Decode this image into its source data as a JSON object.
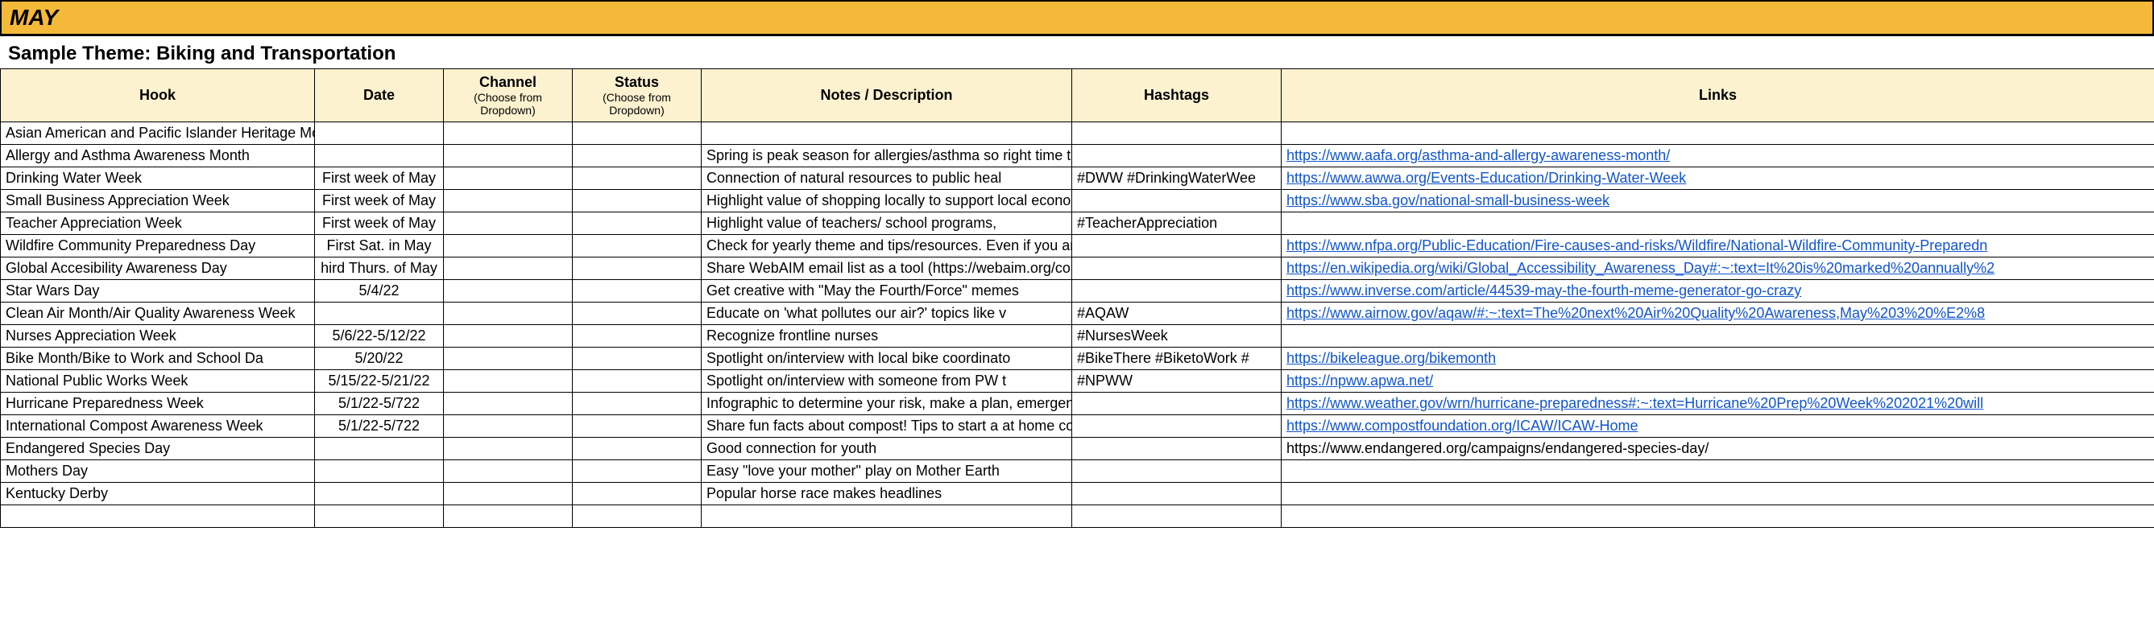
{
  "month_title": "MAY",
  "theme": "Sample Theme: Biking and Transportation",
  "columns": {
    "hook": "Hook",
    "date": "Date",
    "channel": "Channel",
    "channel_sub": "(Choose from Dropdown)",
    "status": "Status",
    "status_sub": "(Choose from Dropdown)",
    "notes": "Notes / Description",
    "hashtags": "Hashtags",
    "links": "Links"
  },
  "rows": [
    {
      "hook": "Asian American and Pacific Islander Heritage Month",
      "date": "",
      "notes": "",
      "hashtags": "",
      "link": "",
      "linkIsUrl": false
    },
    {
      "hook": "Allergy and Asthma Awareness Month",
      "date": "",
      "notes": "Spring is peak season for allergies/asthma so right time to educate about t",
      "hashtags": "",
      "link": "https://www.aafa.org/asthma-and-allergy-awareness-month/",
      "linkIsUrl": true
    },
    {
      "hook": "Drinking Water Week",
      "date": "First week of May",
      "notes": "Connection of natural resources to public heal",
      "hashtags": "#DWW #DrinkingWaterWee",
      "link": "https://www.awwa.org/Events-Education/Drinking-Water-Week",
      "linkIsUrl": true
    },
    {
      "hook": "Small Business Appreciation Week",
      "date": "First week of May",
      "notes": "Highlight value of shopping locally to support local economy, call out speci",
      "hashtags": "",
      "link": "https://www.sba.gov/national-small-business-week",
      "linkIsUrl": true
    },
    {
      "hook": "Teacher Appreciation Week",
      "date": "First week of May",
      "notes": "Highlight value of teachers/ school programs,",
      "hashtags": "#TeacherAppreciation",
      "link": "",
      "linkIsUrl": false
    },
    {
      "hook": "Wildfire Community Preparedness Day",
      "date": "First Sat. in May",
      "notes": "Check for yearly theme and tips/resources. Even if you are not in an area",
      "hashtags": "",
      "link": "https://www.nfpa.org/Public-Education/Fire-causes-and-risks/Wildfire/National-Wildfire-Community-Preparedn",
      "linkIsUrl": true
    },
    {
      "hook": "Global Accesibility Awareness Day",
      "date": "hird Thurs. of May",
      "notes": "Share WebAIM email list as a tool (https://webaim.org/contact/)",
      "hashtags": "",
      "link": "https://en.wikipedia.org/wiki/Global_Accessibility_Awareness_Day#:~:text=It%20is%20marked%20annually%2",
      "linkIsUrl": true
    },
    {
      "hook": "Star Wars Day",
      "date": "5/4/22",
      "notes": "Get creative with \"May the Fourth/Force\" memes",
      "hashtags": "",
      "link": "https://www.inverse.com/article/44539-may-the-fourth-meme-generator-go-crazy",
      "linkIsUrl": true
    },
    {
      "hook": "Clean Air Month/Air Quality Awareness Week",
      "date": "",
      "notes": "Educate on 'what pollutes our air?' topics like v",
      "hashtags": "#AQAW",
      "link": "https://www.airnow.gov/aqaw/#:~:text=The%20next%20Air%20Quality%20Awareness,May%203%20%E2%8",
      "linkIsUrl": true
    },
    {
      "hook": "Nurses Appreciation Week",
      "date": "5/6/22-5/12/22",
      "notes": "Recognize frontline nurses",
      "hashtags": "#NursesWeek",
      "link": "",
      "linkIsUrl": false
    },
    {
      "hook": "Bike Month/Bike to Work and School Da",
      "date": "5/20/22",
      "notes": "Spotlight on/interview with local bike coordinato",
      "hashtags": "#BikeThere #BiketoWork #",
      "link": "https://bikeleague.org/bikemonth",
      "linkIsUrl": true
    },
    {
      "hook": "National Public Works Week",
      "date": "5/15/22-5/21/22",
      "notes": "Spotlight on/interview with someone from PW t",
      "hashtags": "#NPWW",
      "link": "https://npww.apwa.net/",
      "linkIsUrl": true
    },
    {
      "hook": "Hurricane Preparedness Week",
      "date": "5/1/22-5/722",
      "notes": "Infographic to determine your risk, make a plan, emergency supplies etc.",
      "hashtags": "",
      "link": "https://www.weather.gov/wrn/hurricane-preparedness#:~:text=Hurricane%20Prep%20Week%202021%20will",
      "linkIsUrl": true
    },
    {
      "hook": "International Compost Awareness Week",
      "date": "5/1/22-5/722",
      "notes": "Share fun facts about compost! Tips to start a at home compost, highlight",
      "hashtags": "",
      "link": "https://www.compostfoundation.org/ICAW/ICAW-Home",
      "linkIsUrl": true
    },
    {
      "hook": "Endangered Species Day",
      "date": "",
      "notes": "Good connection for youth",
      "hashtags": "",
      "link": "https://www.endangered.org/campaigns/endangered-species-day/",
      "linkIsUrl": false
    },
    {
      "hook": "Mothers Day",
      "date": "",
      "notes": "Easy \"love your mother\" play on Mother Earth",
      "hashtags": "",
      "link": "",
      "linkIsUrl": false
    },
    {
      "hook": "Kentucky Derby",
      "date": "",
      "notes": "Popular horse race makes headlines",
      "hashtags": "",
      "link": "",
      "linkIsUrl": false
    },
    {
      "hook": "",
      "date": "",
      "notes": "",
      "hashtags": "",
      "link": "",
      "linkIsUrl": false
    }
  ]
}
